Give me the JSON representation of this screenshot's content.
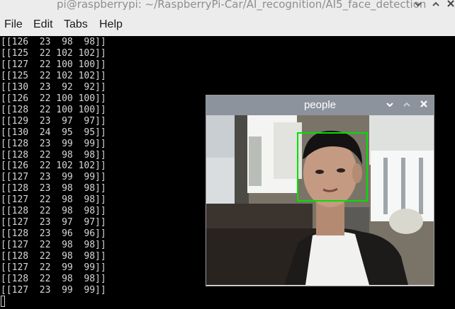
{
  "window": {
    "title": "pi@raspberrypi: ~/RaspberryPi-Car/AI_recognition/AI5_face_detection",
    "minimize_icon": "chevron-down-icon",
    "maximize_icon": "chevron-up-icon",
    "close_icon": "close-icon"
  },
  "menu": {
    "file": "File",
    "edit": "Edit",
    "tabs": "Tabs",
    "help": "Help"
  },
  "terminal": {
    "lines": [
      "[[126  23  98  98]]",
      "[[125  22 102 102]]",
      "[[127  22 100 100]]",
      "[[125  22 102 102]]",
      "[[130  23  92  92]]",
      "[[126  22 100 100]]",
      "[[128  22 100 100]]",
      "[[129  23  97  97]]",
      "[[130  24  95  95]]",
      "[[128  23  99  99]]",
      "[[128  22  98  98]]",
      "[[126  22 102 102]]",
      "[[127  23  99  99]]",
      "[[128  23  98  98]]",
      "[[127  22  98  98]]",
      "[[128  22  98  98]]",
      "[[127  23  97  97]]",
      "[[128  23  96  96]]",
      "[[127  22  98  98]]",
      "[[128  22  98  98]]",
      "[[127  22  99  99]]",
      "[[128  22  98  98]]",
      "[[127  23  99  99]]"
    ]
  },
  "people_window": {
    "title": "people",
    "face_box_color": "#00e000",
    "background_color": "#8c939d"
  }
}
